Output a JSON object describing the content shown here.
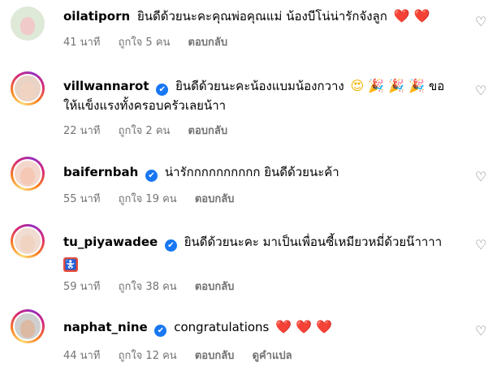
{
  "comments": [
    {
      "username": "oilatiporn",
      "verified": false,
      "text": "ยินดีด้วยนะคะคุณพ่อคุณแม่ น้องบีโน่น่ารักจังลูก",
      "emojis": "❤️ ❤️",
      "time": "41 นาที",
      "likes": "ถูกใจ 5 คน",
      "reply": "ตอบกลับ",
      "avatar_icon": "couple-photo-avatar"
    },
    {
      "username": "villwannarot",
      "verified": true,
      "text": "ยินดีด้วยนะคะน้องแบมน้องกวาง",
      "emojis": "😍 🎉 🎉 🎉",
      "text_after": "ขอ",
      "text_line2": "ให้แข็งแรงทั้งครอบครัวเลยน้าา",
      "time": "22 นาที",
      "likes": "ถูกใจ 2 คน",
      "reply": "ตอบกลับ",
      "avatar_icon": "woman-portrait-avatar"
    },
    {
      "username": "baifernbah",
      "verified": true,
      "text": "น่ารักกกกกกกกกก ยินดีด้วยนะค้า",
      "time": "55 นาที",
      "likes": "ถูกใจ 19 คน",
      "reply": "ตอบกลับ",
      "avatar_icon": "woman-portrait-avatar"
    },
    {
      "username": "tu_piyawadee",
      "verified": true,
      "text": "ยินดีด้วยนะคะ มาเป็นเพื่อนซี้เหมียวหมี่ด้วยน๊าาาา",
      "emojis": "🚼",
      "time": "59 นาที",
      "likes": "ถูกใจ 38 คน",
      "reply": "ตอบกลับ",
      "avatar_icon": "woman-portrait-avatar"
    },
    {
      "username": "naphat_nine",
      "verified": true,
      "text": "congratulations",
      "emojis": "❤️ ❤️ ❤️",
      "time": "44 นาที",
      "likes": "ถูกใจ 12 คน",
      "reply": "ตอบกลับ",
      "translate": "ดูคำแปล",
      "avatar_icon": "man-portrait-avatar"
    }
  ],
  "verified_icon": "✔",
  "like_icon": "♡"
}
